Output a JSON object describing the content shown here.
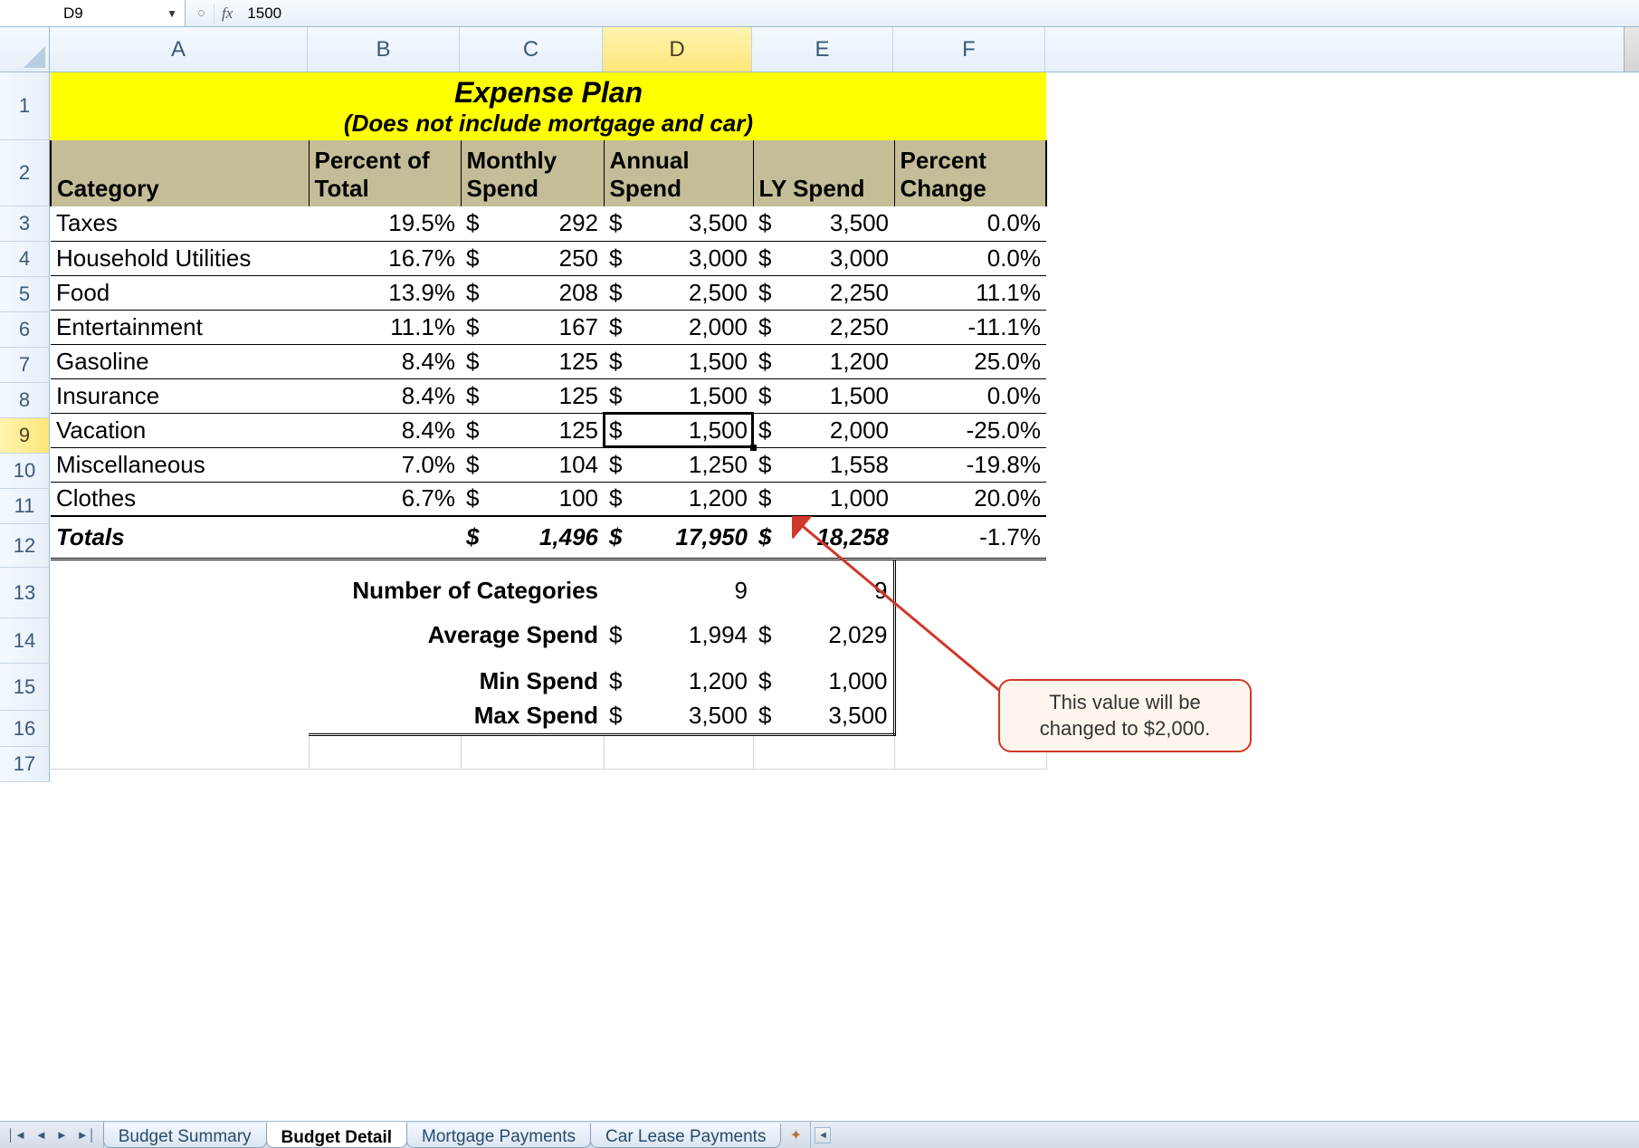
{
  "formula_bar": {
    "cell_ref": "D9",
    "fx_label": "fx",
    "formula": "1500"
  },
  "columns": [
    "A",
    "B",
    "C",
    "D",
    "E",
    "F"
  ],
  "active_column": "D",
  "active_row": "9",
  "row_numbers": [
    "1",
    "2",
    "3",
    "4",
    "5",
    "6",
    "7",
    "8",
    "9",
    "10",
    "11",
    "12",
    "13",
    "14",
    "15",
    "16",
    "17"
  ],
  "title": {
    "line1": "Expense Plan",
    "line2": "(Does not include mortgage and car)"
  },
  "headers": {
    "category": "Category",
    "percent": "Percent of Total",
    "monthly": "Monthly Spend",
    "annual": "Annual Spend",
    "ly": "LY Spend",
    "pchange": "Percent Change"
  },
  "rows": [
    {
      "cat": "Taxes",
      "pct": "19.5%",
      "m": "292",
      "a": "3,500",
      "ly": "3,500",
      "pc": "0.0%"
    },
    {
      "cat": "Household Utilities",
      "pct": "16.7%",
      "m": "250",
      "a": "3,000",
      "ly": "3,000",
      "pc": "0.0%"
    },
    {
      "cat": "Food",
      "pct": "13.9%",
      "m": "208",
      "a": "2,500",
      "ly": "2,250",
      "pc": "11.1%"
    },
    {
      "cat": "Entertainment",
      "pct": "11.1%",
      "m": "167",
      "a": "2,000",
      "ly": "2,250",
      "pc": "-11.1%"
    },
    {
      "cat": "Gasoline",
      "pct": "8.4%",
      "m": "125",
      "a": "1,500",
      "ly": "1,200",
      "pc": "25.0%"
    },
    {
      "cat": "Insurance",
      "pct": "8.4%",
      "m": "125",
      "a": "1,500",
      "ly": "1,500",
      "pc": "0.0%"
    },
    {
      "cat": "Vacation",
      "pct": "8.4%",
      "m": "125",
      "a": "1,500",
      "ly": "2,000",
      "pc": "-25.0%"
    },
    {
      "cat": "Miscellaneous",
      "pct": "7.0%",
      "m": "104",
      "a": "1,250",
      "ly": "1,558",
      "pc": "-19.8%"
    },
    {
      "cat": "Clothes",
      "pct": "6.7%",
      "m": "100",
      "a": "1,200",
      "ly": "1,000",
      "pc": "20.0%"
    }
  ],
  "currency": "$",
  "totals": {
    "label": "Totals",
    "m": "1,496",
    "a": "17,950",
    "ly": "18,258",
    "pc": "-1.7%"
  },
  "summary": {
    "numcat_label": "Number of Categories",
    "numcat_d": "9",
    "numcat_e": "9",
    "avg_label": "Average Spend",
    "avg_d": "1,994",
    "avg_e": "2,029",
    "min_label": "Min Spend",
    "min_d": "1,200",
    "min_e": "1,000",
    "max_label": "Max Spend",
    "max_d": "3,500",
    "max_e": "3,500"
  },
  "callout": "This value will be changed to $2,000.",
  "tabs": {
    "t1": "Budget Summary",
    "t2": "Budget Detail",
    "t3": "Mortgage Payments",
    "t4": "Car Lease Payments"
  }
}
